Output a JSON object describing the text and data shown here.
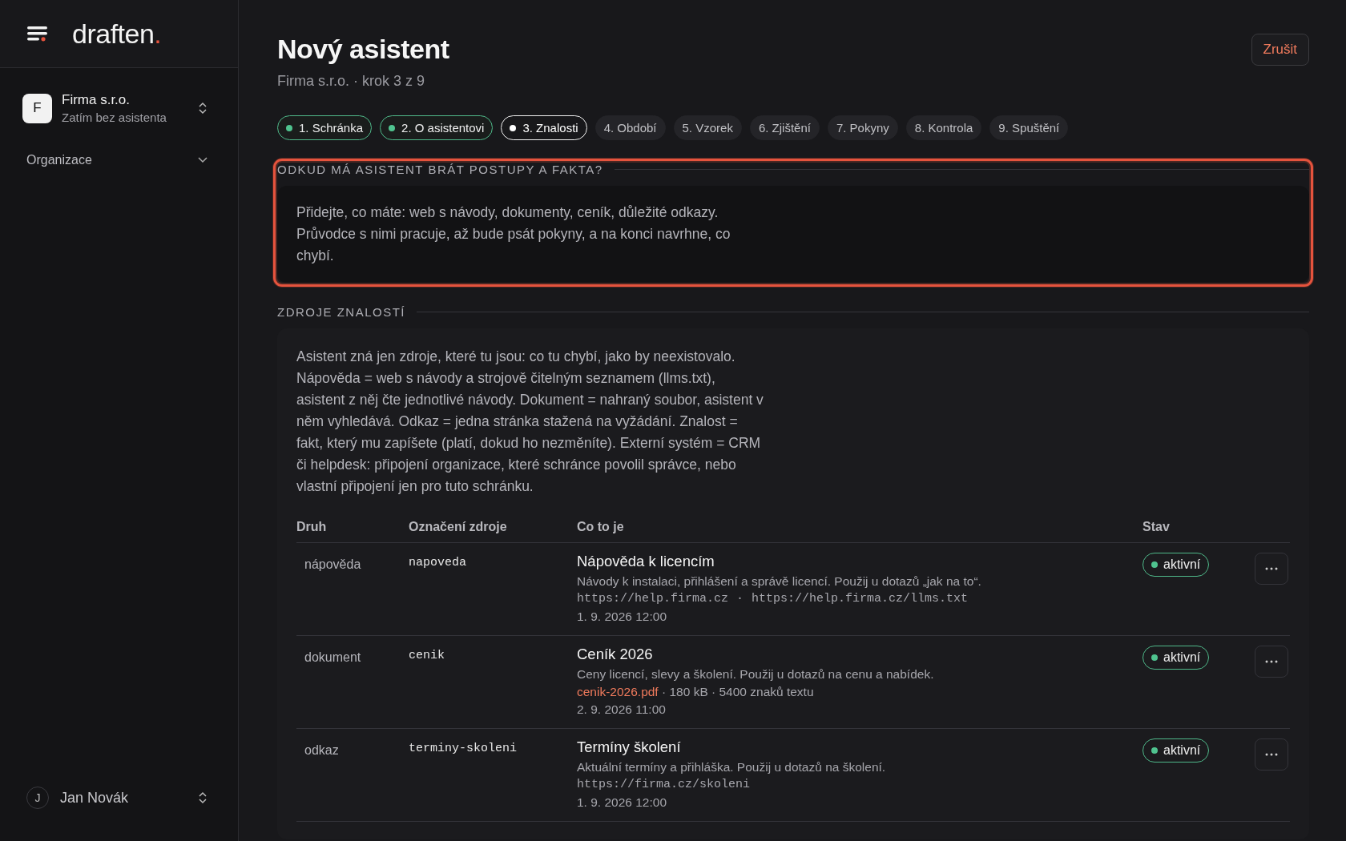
{
  "sidebar": {
    "logo": "draften",
    "logo_dot": ".",
    "org": {
      "avatar": "F",
      "name": "Firma s.r.o.",
      "subtitle": "Zatím bez asistenta"
    },
    "nav": [
      {
        "label": "Organizace",
        "expanded": false
      }
    ],
    "user": {
      "avatar": "J",
      "name": "Jan Novák"
    }
  },
  "header": {
    "title": "Nový asistent",
    "subtitle": "Firma s.r.o. · krok 3 z 9",
    "cancel": "Zrušit"
  },
  "steps": [
    {
      "label": "1. Schránka",
      "done": true,
      "selected": false
    },
    {
      "label": "2. O asistentovi",
      "done": true,
      "selected": false
    },
    {
      "label": "3. Znalosti",
      "done": false,
      "selected": true
    },
    {
      "label": "4. Období",
      "done": false,
      "selected": false
    },
    {
      "label": "5. Vzorek",
      "done": false,
      "selected": false
    },
    {
      "label": "6. Zjištění",
      "done": false,
      "selected": false
    },
    {
      "label": "7. Pokyny",
      "done": false,
      "selected": false
    },
    {
      "label": "8. Kontrola",
      "done": false,
      "selected": false
    },
    {
      "label": "9. Spuštění",
      "done": false,
      "selected": false
    }
  ],
  "intro_section": {
    "heading": "ODKUD MÁ ASISTENT BRÁT POSTUPY A FAKTA?",
    "highlighted": true,
    "text": "Přidejte, co máte: web s návody, dokumenty, ceník, důležité odkazy. Průvodce s nimi pracuje, až bude psát pokyny, a na konci navrhne, co chybí."
  },
  "sources_section": {
    "heading": "ZDROJE ZNALOSTÍ",
    "text": "Asistent zná jen zdroje, které tu jsou: co tu chybí, jako by neexistovalo. Nápověda = web s návody a strojově čitelným seznamem (llms.txt), asistent z něj čte jednotlivé návody. Dokument = nahraný soubor, asistent v něm vyhledává. Odkaz = jedna stránka stažená na vyžádání. Znalost = fakt, který mu zapíšete (platí, dokud ho nezměníte). Externí systém = CRM či helpdesk: připojení organizace, které schránce povolil správce, nebo vlastní připojení jen pro tuto schránku.",
    "table": {
      "columns": [
        "Druh",
        "Označení zdroje",
        "Co to je",
        "Stav"
      ],
      "rows": [
        {
          "kind": "nápověda",
          "slug": "napoveda",
          "title": "Nápověda k licencím",
          "description": "Návody k instalaci, přihlášení a správě licencí. Použij u dotazů „jak na to“.",
          "urls": [
            "https://help.firma.cz",
            "https://help.firma.cz/llms.txt"
          ],
          "url_separator": "·",
          "date": "1. 9. 2026 12:00",
          "status": "aktivní",
          "active": true
        },
        {
          "kind": "dokument",
          "slug": "cenik",
          "title": "Ceník 2026",
          "description": "Ceny licencí, slevy a školení. Použij u dotazů na cenu a nabídek.",
          "file": "cenik-2026.pdf",
          "meta": " · 180 kB · 5400 znaků textu",
          "date": "2. 9. 2026 11:00",
          "status": "aktivní",
          "active": true
        },
        {
          "kind": "odkaz",
          "slug": "terminy-skoleni",
          "title": "Termíny školení",
          "description": "Aktuální termíny a přihláška. Použij u dotazů na školení.",
          "urls": [
            "https://firma.cz/skoleni"
          ],
          "date": "1. 9. 2026 12:00",
          "status": "aktivní",
          "active": true
        }
      ]
    }
  }
}
